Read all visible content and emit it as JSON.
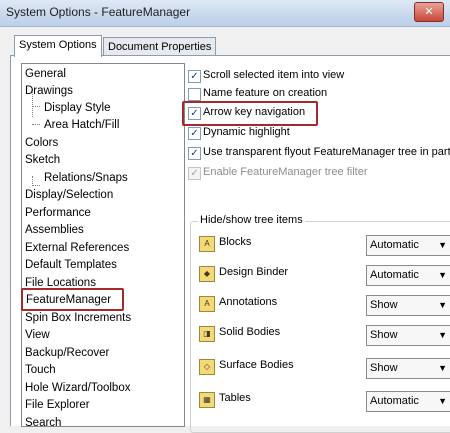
{
  "window": {
    "title": "System Options - FeatureManager",
    "close_glyph": "✕"
  },
  "tabs": [
    {
      "label": "System Options",
      "active": true
    },
    {
      "label": "Document Properties",
      "active": false
    }
  ],
  "nav": {
    "items": [
      {
        "label": "General",
        "indent": 0
      },
      {
        "label": "Drawings",
        "indent": 0
      },
      {
        "label": "Display Style",
        "indent": 1
      },
      {
        "label": "Area Hatch/Fill",
        "indent": 1
      },
      {
        "label": "Colors",
        "indent": 0
      },
      {
        "label": "Sketch",
        "indent": 0
      },
      {
        "label": "Relations/Snaps",
        "indent": 1
      },
      {
        "label": "Display/Selection",
        "indent": 0
      },
      {
        "label": "Performance",
        "indent": 0
      },
      {
        "label": "Assemblies",
        "indent": 0
      },
      {
        "label": "External References",
        "indent": 0
      },
      {
        "label": "Default Templates",
        "indent": 0
      },
      {
        "label": "File Locations",
        "indent": 0
      },
      {
        "label": "FeatureManager",
        "indent": 0,
        "selected": true
      },
      {
        "label": "Spin Box Increments",
        "indent": 0
      },
      {
        "label": "View",
        "indent": 0
      },
      {
        "label": "Backup/Recover",
        "indent": 0
      },
      {
        "label": "Touch",
        "indent": 0
      },
      {
        "label": "Hole Wizard/Toolbox",
        "indent": 0
      },
      {
        "label": "File Explorer",
        "indent": 0
      },
      {
        "label": "Search",
        "indent": 0
      }
    ]
  },
  "options": {
    "checkboxes": [
      {
        "label": "Scroll selected item into view",
        "checked": true,
        "enabled": true
      },
      {
        "label": "Name feature on creation",
        "checked": false,
        "enabled": true
      },
      {
        "label": "Arrow key navigation",
        "checked": true,
        "enabled": true,
        "highlighted": true
      },
      {
        "label": "Dynamic highlight",
        "checked": true,
        "enabled": true
      },
      {
        "label": "Use transparent flyout FeatureManager tree in parts",
        "checked": true,
        "enabled": true
      },
      {
        "label": "Enable FeatureManager tree filter",
        "checked": true,
        "enabled": false
      }
    ]
  },
  "tree_items": {
    "group_label": "Hide/show tree items",
    "rows": [
      {
        "label": "Blocks",
        "value": "Automatic",
        "icon": "blocks-icon",
        "glyph": "A"
      },
      {
        "label": "Design Binder",
        "value": "Automatic",
        "icon": "design-binder-icon",
        "glyph": "◆"
      },
      {
        "label": "Annotations",
        "value": "Show",
        "icon": "annotations-icon",
        "glyph": "A"
      },
      {
        "label": "Solid Bodies",
        "value": "Show",
        "icon": "solid-bodies-icon",
        "glyph": "◨"
      },
      {
        "label": "Surface Bodies",
        "value": "Show",
        "icon": "surface-bodies-icon",
        "glyph": "◇"
      },
      {
        "label": "Tables",
        "value": "Automatic",
        "icon": "tables-icon",
        "glyph": "▦"
      }
    ],
    "dropdown_glyph": "▼"
  },
  "colors": {
    "highlight_border": "#a8292c",
    "title_bar": "#c7d8ec",
    "checkmark": "#16398a"
  }
}
